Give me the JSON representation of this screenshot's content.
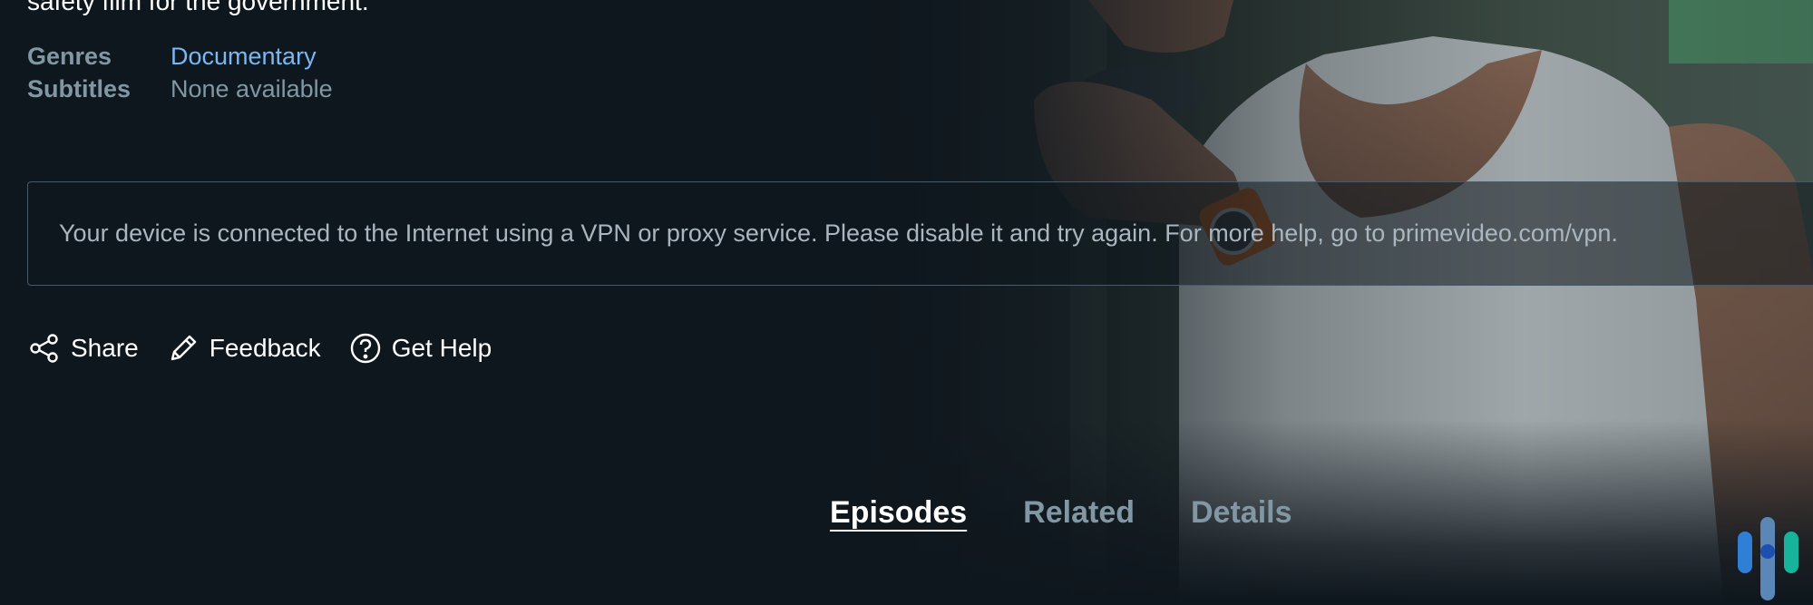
{
  "synopsis_tail": "safety film for the government.",
  "meta": {
    "genres_label": "Genres",
    "genres_value": "Documentary",
    "subtitles_label": "Subtitles",
    "subtitles_value": "None available"
  },
  "notice": {
    "text": "Your device is connected to the Internet using a VPN or proxy service. Please disable it and try again. For more help, go to primevideo.com/vpn."
  },
  "actions": [
    {
      "label": "Share",
      "icon": "share-icon"
    },
    {
      "label": "Feedback",
      "icon": "pencil-icon"
    },
    {
      "label": "Get Help",
      "icon": "help-circle-icon"
    }
  ],
  "tabs": [
    {
      "label": "Episodes",
      "active": true
    },
    {
      "label": "Related",
      "active": false
    },
    {
      "label": "Details",
      "active": false
    }
  ],
  "colors": {
    "background": "#0f171e",
    "link": "#79b8f3",
    "muted": "#8197a4",
    "watermark_blue": "#2f7fd6",
    "watermark_teal": "#17b39b"
  }
}
